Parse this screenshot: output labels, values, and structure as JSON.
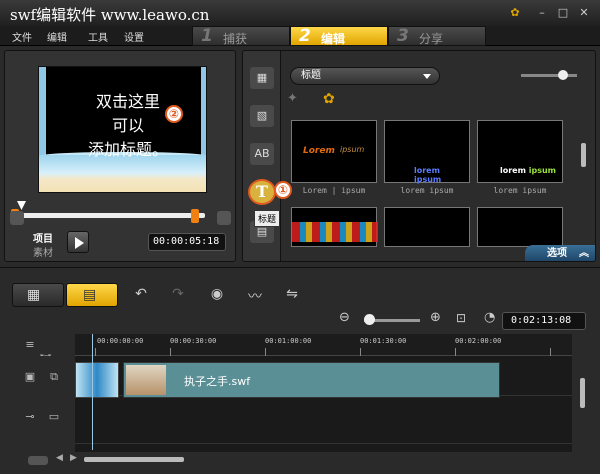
{
  "window": {
    "title": "swf编辑软件 www.leawo.cn"
  },
  "menu": [
    "文件",
    "编辑",
    "工具",
    "设置"
  ],
  "steps": [
    {
      "num": "1",
      "label": "捕获",
      "active": false
    },
    {
      "num": "2",
      "label": "编辑",
      "active": true
    },
    {
      "num": "3",
      "label": "分享",
      "active": false
    }
  ],
  "preview": {
    "overlay_text_lines": [
      "双击这里",
      "可以",
      "添加标题。"
    ],
    "marker": "②",
    "mode_project": "项目",
    "mode_clip": "素材",
    "timecode": "00:00:05:18"
  },
  "library": {
    "category": "标题",
    "marker": "①",
    "tab_title_glyph": "T",
    "tooltip": "标题",
    "thumbs": [
      {
        "label": "Lorem | ipsum"
      },
      {
        "label": "lorem ipsum"
      },
      {
        "label": "lorem ipsum"
      }
    ],
    "options_label": "选项"
  },
  "timeline": {
    "timecode": "0:02:13:08",
    "ruler_labels": [
      "00:00:00:00",
      "00:00:30:00",
      "00:01:00:00",
      "00:01:30:00",
      "00:02:00:00"
    ],
    "clip_name": "执子之手.swf"
  },
  "colors": {
    "accent": "#e0a400",
    "marker": "#e05a20",
    "options": "#1d4466"
  }
}
